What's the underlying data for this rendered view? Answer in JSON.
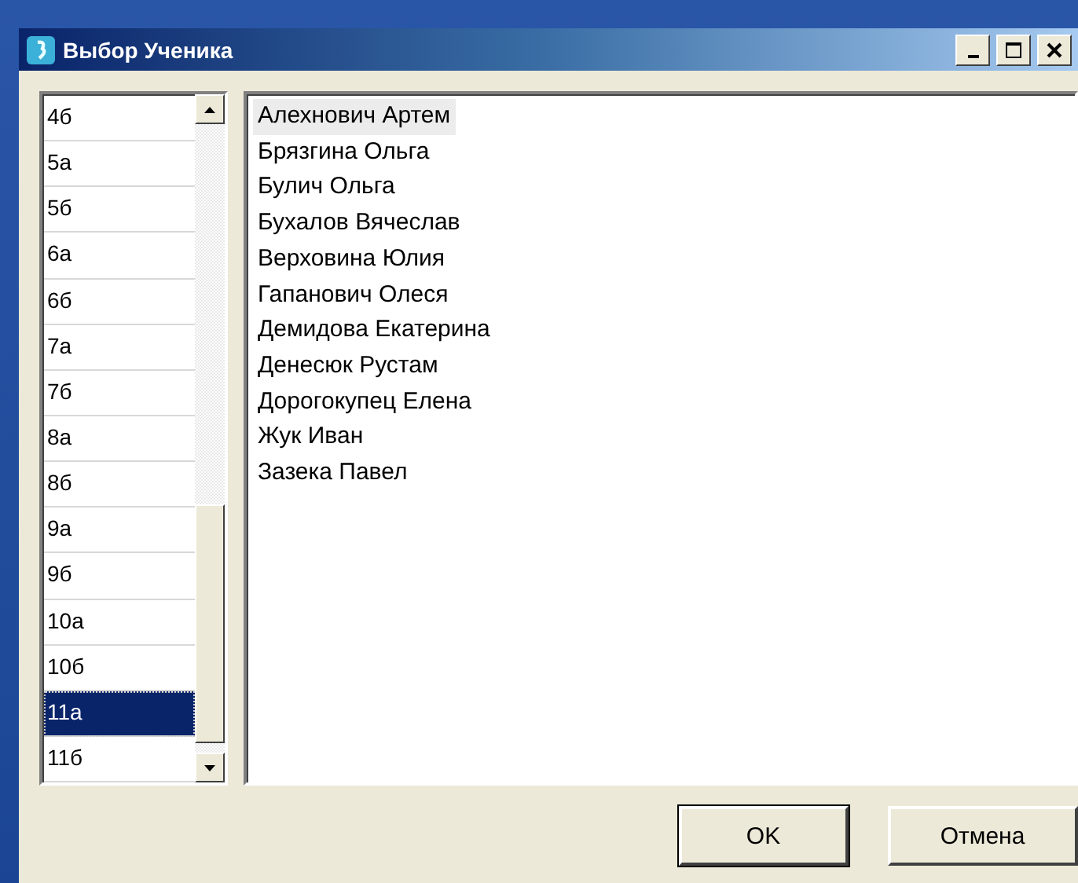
{
  "window": {
    "title": "Выбор Ученика"
  },
  "classes": [
    {
      "label": "4б",
      "selected": false
    },
    {
      "label": "5а",
      "selected": false
    },
    {
      "label": "5б",
      "selected": false
    },
    {
      "label": "6а",
      "selected": false
    },
    {
      "label": "6б",
      "selected": false
    },
    {
      "label": "7а",
      "selected": false
    },
    {
      "label": "7б",
      "selected": false
    },
    {
      "label": "8а",
      "selected": false
    },
    {
      "label": "8б",
      "selected": false
    },
    {
      "label": "9а",
      "selected": false
    },
    {
      "label": "9б",
      "selected": false
    },
    {
      "label": "10а",
      "selected": false
    },
    {
      "label": "10б",
      "selected": false
    },
    {
      "label": "11а",
      "selected": true
    },
    {
      "label": "11б",
      "selected": false
    }
  ],
  "students": [
    {
      "name": "Алехнович Артем",
      "selected": true
    },
    {
      "name": "Брязгина Ольга",
      "selected": false
    },
    {
      "name": "Булич Ольга",
      "selected": false
    },
    {
      "name": "Бухалов Вячеслав",
      "selected": false
    },
    {
      "name": "Верховина Юлия",
      "selected": false
    },
    {
      "name": "Гапанович Олеся",
      "selected": false
    },
    {
      "name": "Демидова Екатерина",
      "selected": false
    },
    {
      "name": "Денесюк Рустам",
      "selected": false
    },
    {
      "name": "Дорогокупец Елена",
      "selected": false
    },
    {
      "name": "Жук Иван",
      "selected": false
    },
    {
      "name": "Зазека Павел",
      "selected": false
    }
  ],
  "buttons": [
    "OK",
    "Отмена"
  ]
}
